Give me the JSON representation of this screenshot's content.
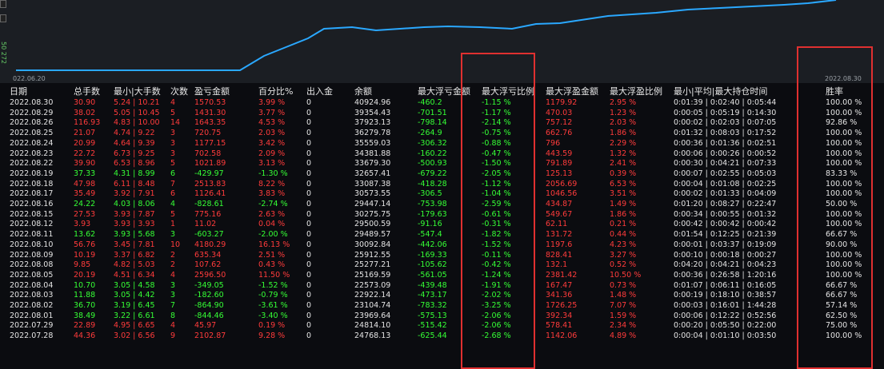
{
  "chart": {
    "start_date": "022.06.20",
    "end_date": "2022.08.30",
    "line_color": "#2aa8ff"
  },
  "colors": {
    "positive": "#ff3b3b",
    "negative": "#35ff35",
    "highlight_box": "#e03030"
  },
  "side_label": "50 272",
  "headers": [
    "日期",
    "总手数",
    "最小|大手数",
    "次数",
    "盈亏金额",
    "百分比%",
    "出入金",
    "余额",
    "最大浮亏金额",
    "最大浮亏比例",
    "最大浮盈金额",
    "最大浮盈比例",
    "最小|平均|最大持仓时间",
    "胜率"
  ],
  "rows": [
    [
      "2022.08.30",
      "30.90",
      "5.24 | 10.21",
      "4",
      "1570.53",
      "3.99 %",
      "0",
      "40924.96",
      "-460.2",
      "-1.15 %",
      "1179.92",
      "2.95 %",
      "0:01:39 | 0:02:40 | 0:05:44",
      "100.00 %"
    ],
    [
      "2022.08.29",
      "38.02",
      "5.05 | 10.45",
      "5",
      "1431.30",
      "3.77 %",
      "0",
      "39354.43",
      "-701.51",
      "-1.17 %",
      "470.03",
      "1.23 %",
      "0:00:05 | 0:05:19 | 0:14:30",
      "100.00 %"
    ],
    [
      "2022.08.26",
      "116.93",
      "4.83 | 10.00",
      "14",
      "1643.35",
      "4.53 %",
      "0",
      "37923.13",
      "-798.14",
      "-2.14 %",
      "757.12",
      "2.03 %",
      "0:00:02 | 0:02:03 | 0:07:05",
      "92.86 %"
    ],
    [
      "2022.08.25",
      "21.07",
      "4.74 | 9.22",
      "3",
      "720.75",
      "2.03 %",
      "0",
      "36279.78",
      "-264.9",
      "-0.75 %",
      "662.76",
      "1.86 %",
      "0:01:32 | 0:08:03 | 0:17:52",
      "100.00 %"
    ],
    [
      "2022.08.24",
      "20.99",
      "4.64 | 9.39",
      "3",
      "1177.15",
      "3.42 %",
      "0",
      "35559.03",
      "-306.32",
      "-0.88 %",
      "796",
      "2.29 %",
      "0:00:36 | 0:01:36 | 0:02:51",
      "100.00 %"
    ],
    [
      "2022.08.23",
      "22.72",
      "6.73 | 9.25",
      "3",
      "702.58",
      "2.09 %",
      "0",
      "34381.88",
      "-160.22",
      "-0.47 %",
      "443.59",
      "1.32 %",
      "0:00:06 | 0:00:26 | 0:00:52",
      "100.00 %"
    ],
    [
      "2022.08.22",
      "39.90",
      "6.53 | 8.96",
      "5",
      "1021.89",
      "3.13 %",
      "0",
      "33679.30",
      "-500.93",
      "-1.50 %",
      "791.89",
      "2.41 %",
      "0:00:30 | 0:04:21 | 0:07:33",
      "100.00 %"
    ],
    [
      "2022.08.19",
      "37.33",
      "4.31 | 8.99",
      "6",
      "-429.97",
      "-1.30 %",
      "0",
      "32657.41",
      "-679.22",
      "-2.05 %",
      "125.13",
      "0.39 %",
      "0:00:07 | 0:02:55 | 0:05:03",
      "83.33 %"
    ],
    [
      "2022.08.18",
      "47.98",
      "6.11 | 8.48",
      "7",
      "2513.83",
      "8.22 %",
      "0",
      "33087.38",
      "-418.28",
      "-1.12 %",
      "2056.69",
      "6.53 %",
      "0:00:04 | 0:01:08 | 0:02:25",
      "100.00 %"
    ],
    [
      "2022.08.17",
      "35.49",
      "3.92 | 7.91",
      "6",
      "1126.41",
      "3.83 %",
      "0",
      "30573.55",
      "-306.5",
      "-1.04 %",
      "1046.56",
      "3.51 %",
      "0:00:02 | 0:01:33 | 0:04:09",
      "100.00 %"
    ],
    [
      "2022.08.16",
      "24.22",
      "4.03 | 8.06",
      "4",
      "-828.61",
      "-2.74 %",
      "0",
      "29447.14",
      "-753.98",
      "-2.59 %",
      "434.87",
      "1.49 %",
      "0:01:20 | 0:08:27 | 0:22:47",
      "50.00 %"
    ],
    [
      "2022.08.15",
      "27.53",
      "3.93 | 7.87",
      "5",
      "775.16",
      "2.63 %",
      "0",
      "30275.75",
      "-179.63",
      "-0.61 %",
      "549.67",
      "1.86 %",
      "0:00:34 | 0:00:55 | 0:01:32",
      "100.00 %"
    ],
    [
      "2022.08.12",
      "3.93",
      "3.93 | 3.93",
      "1",
      "11.02",
      "0.04 %",
      "0",
      "29500.59",
      "-91.16",
      "-0.31 %",
      "62.11",
      "0.21 %",
      "0:00:42 | 0:00:42 | 0:00:42",
      "100.00 %"
    ],
    [
      "2022.08.11",
      "13.62",
      "3.93 | 5.68",
      "3",
      "-603.27",
      "-2.00 %",
      "0",
      "29489.57",
      "-547.4",
      "-1.82 %",
      "131.72",
      "0.44 %",
      "0:01:54 | 0:12:25 | 0:21:39",
      "66.67 %"
    ],
    [
      "2022.08.10",
      "56.76",
      "3.45 | 7.81",
      "10",
      "4180.29",
      "16.13 %",
      "0",
      "30092.84",
      "-442.06",
      "-1.52 %",
      "1197.6",
      "4.23 %",
      "0:00:01 | 0:03:37 | 0:19:09",
      "90.00 %"
    ],
    [
      "2022.08.09",
      "10.19",
      "3.37 | 6.82",
      "2",
      "635.34",
      "2.51 %",
      "0",
      "25912.55",
      "-169.33",
      "-0.11 %",
      "828.41",
      "3.27 %",
      "0:00:10 | 0:00:18 | 0:00:27",
      "100.00 %"
    ],
    [
      "2022.08.08",
      "9.85",
      "4.82 | 5.03",
      "2",
      "107.62",
      "0.43 %",
      "0",
      "25277.21",
      "-105.62",
      "-0.42 %",
      "132.1",
      "0.52 %",
      "0:04:20 | 0:04:21 | 0:04:23",
      "100.00 %"
    ],
    [
      "2022.08.05",
      "20.19",
      "4.51 | 6.34",
      "4",
      "2596.50",
      "11.50 %",
      "0",
      "25169.59",
      "-561.05",
      "-1.24 %",
      "2381.42",
      "10.50 %",
      "0:00:36 | 0:26:58 | 1:20:16",
      "100.00 %"
    ],
    [
      "2022.08.04",
      "10.70",
      "3.05 | 4.58",
      "3",
      "-349.05",
      "-1.52 %",
      "0",
      "22573.09",
      "-439.48",
      "-1.91 %",
      "167.47",
      "0.73 %",
      "0:01:07 | 0:06:11 | 0:16:05",
      "66.67 %"
    ],
    [
      "2022.08.03",
      "11.88",
      "3.05 | 4.42",
      "3",
      "-182.60",
      "-0.79 %",
      "0",
      "22922.14",
      "-473.17",
      "-2.02 %",
      "341.36",
      "1.48 %",
      "0:00:19 | 0:18:10 | 0:38:57",
      "66.67 %"
    ],
    [
      "2022.08.02",
      "36.70",
      "3.19 | 6.45",
      "7",
      "-864.90",
      "-3.61 %",
      "0",
      "23104.74",
      "-783.32",
      "-3.25 %",
      "1726.25",
      "7.07 %",
      "0:00:03 | 0:16:01 | 1:44:28",
      "57.14 %"
    ],
    [
      "2022.08.01",
      "38.49",
      "3.22 | 6.61",
      "8",
      "-844.46",
      "-3.40 %",
      "0",
      "23969.64",
      "-575.13",
      "-2.06 %",
      "392.34",
      "1.59 %",
      "0:00:06 | 0:12:22 | 0:52:56",
      "62.50 %"
    ],
    [
      "2022.07.29",
      "22.89",
      "4.95 | 6.65",
      "4",
      "45.97",
      "0.19 %",
      "0",
      "24814.10",
      "-515.42",
      "-2.06 %",
      "578.41",
      "2.34 %",
      "0:00:20 | 0:05:50 | 0:22:00",
      "75.00 %"
    ],
    [
      "2022.07.28",
      "44.36",
      "3.02 | 6.56",
      "9",
      "2102.87",
      "9.28 %",
      "0",
      "24768.13",
      "-625.44",
      "-2.68 %",
      "1142.06",
      "4.89 %",
      "0:00:04 | 0:01:10 | 0:03:50",
      "100.00 %"
    ]
  ]
}
